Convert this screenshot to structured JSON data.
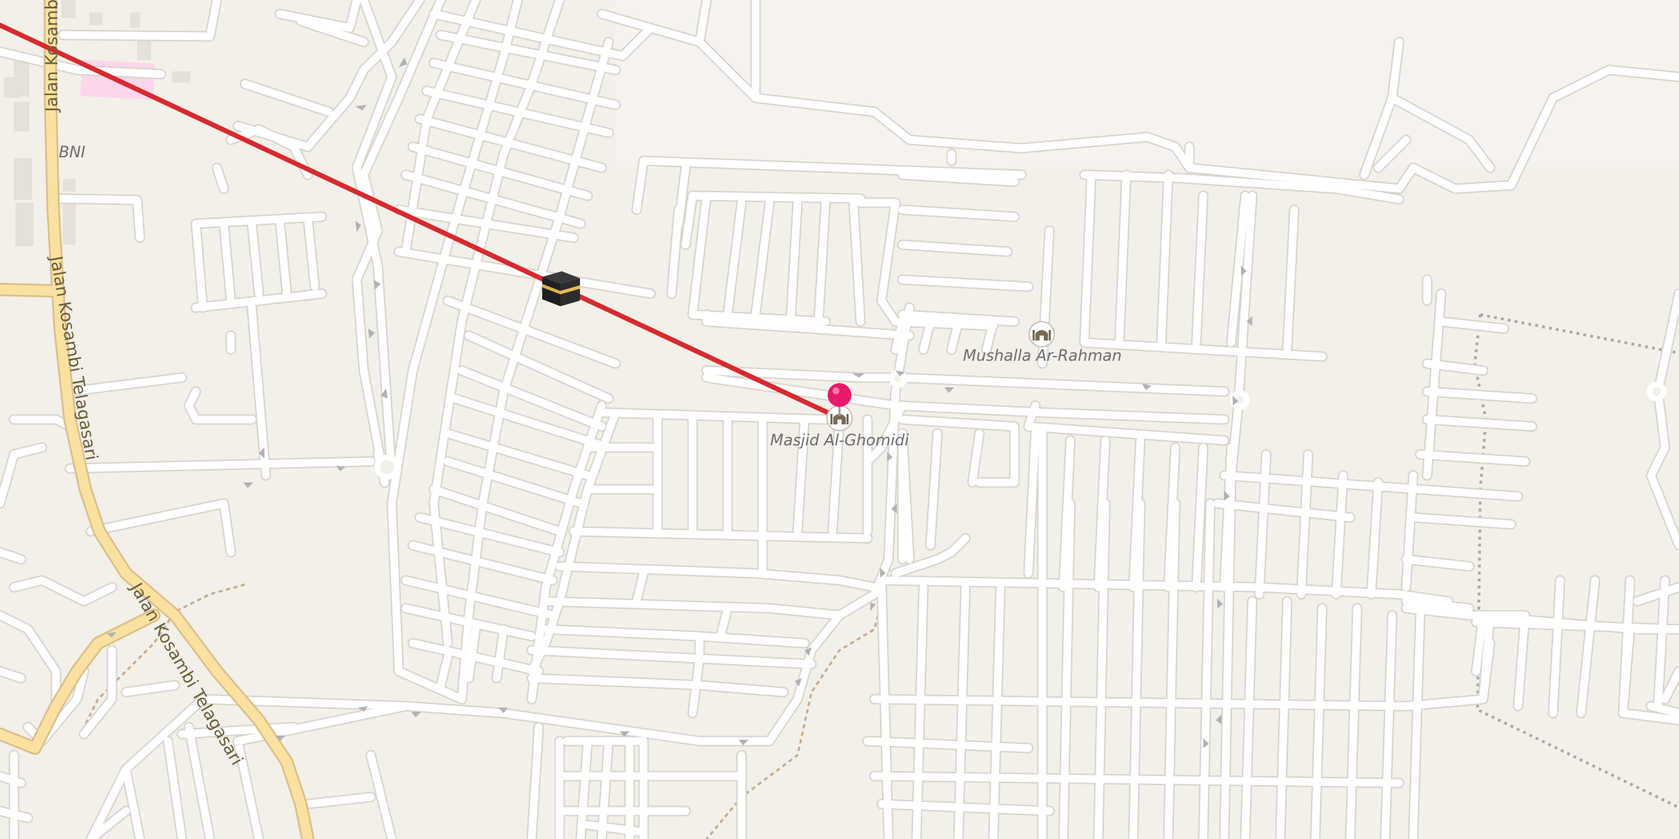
{
  "map": {
    "colors": {
      "background": "#f3efe9",
      "street": "#ffffff",
      "major_road": "#fbe1a0",
      "qibla_line": "#d62a2f",
      "pin": "#e8196b",
      "building": "#e5e0d8",
      "commercial_area": "#fcd6ea"
    },
    "road_labels": [
      {
        "text": "Jalan Kosambi"
      },
      {
        "text": "Jalan Kosambi Telagasari"
      },
      {
        "text": "Jalan Kosambi Telagasari"
      }
    ],
    "pois": [
      {
        "text": "BNI"
      },
      {
        "text": "Mushalla Ar-Rahman",
        "icon": "mosque-icon"
      },
      {
        "text": "Masjid Al-Ghomidi",
        "icon": "mosque-icon"
      }
    ],
    "markers": {
      "pin": "location-pin-icon",
      "kaaba": "kaaba-icon",
      "line": "qibla-direction-line"
    }
  }
}
